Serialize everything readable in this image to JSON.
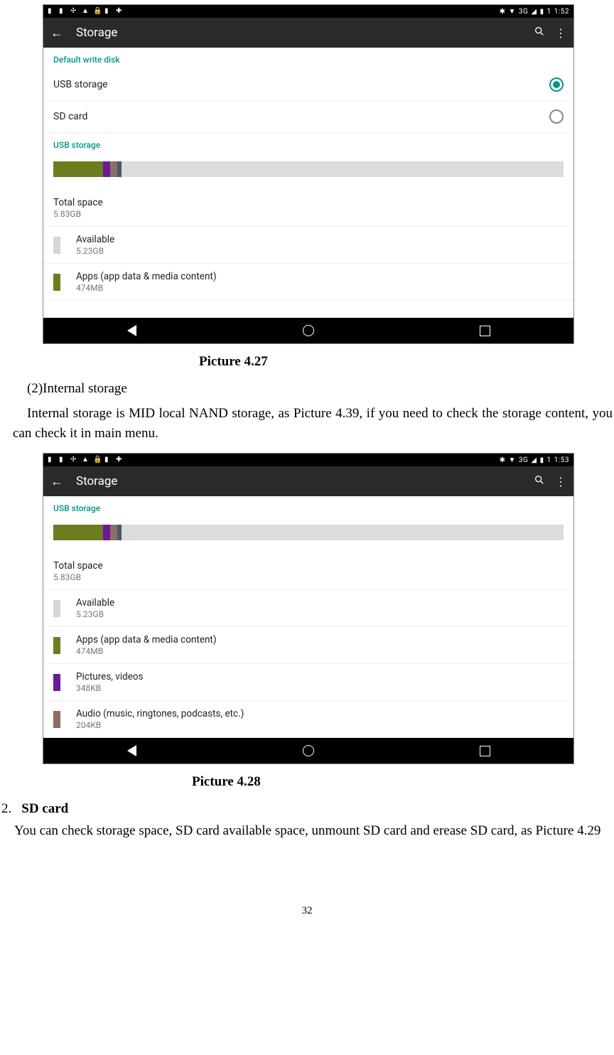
{
  "screenshot1": {
    "status": {
      "network": "3G",
      "battery": "1",
      "time": "1:52"
    },
    "toolbar": {
      "title": "Storage"
    },
    "section_default": "Default write disk",
    "opt_usb": "USB storage",
    "opt_sd": "SD card",
    "section_usb": "USB storage",
    "total": {
      "label": "Total space",
      "value": "5.83GB"
    },
    "available": {
      "label": "Available",
      "value": "5.23GB"
    },
    "apps": {
      "label": "Apps (app data & media content)",
      "value": "474MB"
    }
  },
  "caption1": "Picture 4.27",
  "para_sub": "(2)Internal storage",
  "para1": "Internal storage is MID local NAND storage, as Picture 4.39, if you need to check the storage content, you can check it in main menu.",
  "screenshot2": {
    "status": {
      "network": "3G",
      "battery": "1",
      "time": "1:53"
    },
    "toolbar": {
      "title": "Storage"
    },
    "section_usb": "USB storage",
    "total": {
      "label": "Total space",
      "value": "5.83GB"
    },
    "available": {
      "label": "Available",
      "value": "5.23GB"
    },
    "apps": {
      "label": "Apps (app data & media content)",
      "value": "474MB"
    },
    "pics": {
      "label": "Pictures, videos",
      "value": "348KB"
    },
    "audio": {
      "label": "Audio (music, ringtones, podcasts, etc.)",
      "value": "204KB"
    }
  },
  "caption2": "Picture 4.28",
  "list2": {
    "num": "2.",
    "head": "SD card"
  },
  "para2": "You can check storage space, SD card available space, unmount SD card and erease SD card, as Picture 4.29",
  "pagenum": "32"
}
